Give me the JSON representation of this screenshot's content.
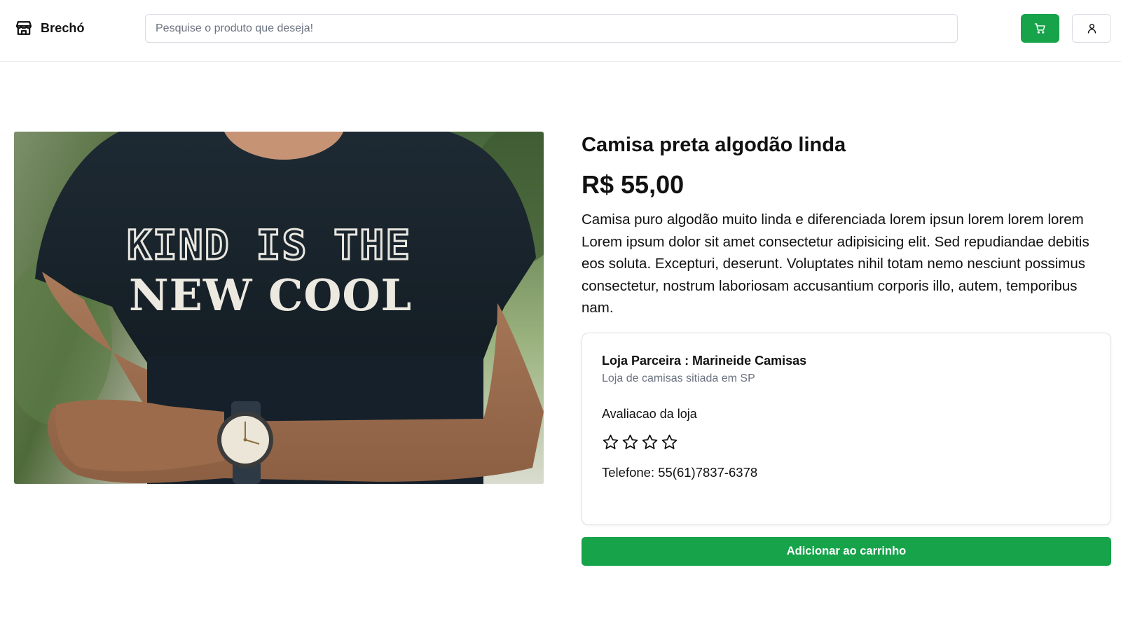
{
  "brand": {
    "name": "Brechó",
    "icon": "store-icon"
  },
  "search": {
    "placeholder": "Pesquise o produto que deseja!",
    "value": ""
  },
  "header": {
    "cart_icon": "shopping-cart-icon",
    "user_icon": "user-icon",
    "cart_color": "#16a34a"
  },
  "product": {
    "image_icon": "product-photo",
    "image_text_line1": "KIND IS THE",
    "image_text_line2": "NEW COOL",
    "title": "Camisa preta algodão linda",
    "price": "R$ 55,00",
    "description": "Camisa puro algodão muito linda e diferenciada lorem ipsun lorem lorem lorem Lorem ipsum dolor sit amet consectetur adipisicing elit. Sed repudiandae debitis eos soluta. Excepturi, deserunt. Voluptates nihil totam nemo nesciunt possimus consectetur, nostrum laboriosam accusantium corporis illo, autem, temporibus nam."
  },
  "store": {
    "name": "Loja Parceira : Marineide Camisas",
    "description": "Loja de camisas sitiada em SP",
    "rating_label": "Avaliacao da loja",
    "rating": 0,
    "rating_max": 4,
    "phone": "Telefone: 55(61)7837-6378"
  },
  "actions": {
    "add_to_cart": "Adicionar ao carrinho",
    "accent_color": "#16a34a"
  }
}
